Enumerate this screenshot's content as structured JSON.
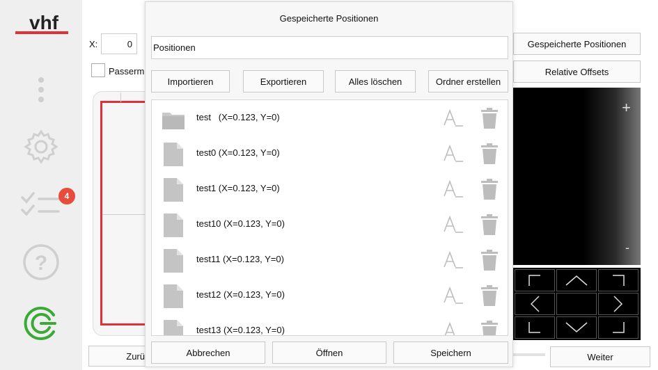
{
  "sidebar": {
    "logo_text": "vhf",
    "badge_count": "4",
    "icons": [
      "menu-dots-icon",
      "settings-gear-icon",
      "task-list-icon",
      "help-icon",
      "vhf-brand-icon"
    ]
  },
  "background": {
    "x_label": "X:",
    "x_value": "0",
    "checkbox_label": "Passerm",
    "saved_positions_button": "Gespeicherte Positionen",
    "relative_offsets_button": "Relative Offsets",
    "back_button": "Zurü",
    "next_button": "Weiter",
    "zoom_plus": "+",
    "zoom_minus": "-"
  },
  "dialog": {
    "title": "Gespeicherte Positionen",
    "name_value": "Positionen",
    "buttons": {
      "import": "Importieren",
      "export": "Exportieren",
      "clear_all": "Alles löschen",
      "create_folder": "Ordner erstellen"
    },
    "items": [
      {
        "type": "folder",
        "label": "test   (X=0.123, Y=0)"
      },
      {
        "type": "file",
        "label": "test0 (X=0.123, Y=0)"
      },
      {
        "type": "file",
        "label": "test1 (X=0.123, Y=0)"
      },
      {
        "type": "file",
        "label": "test10 (X=0.123, Y=0)"
      },
      {
        "type": "file",
        "label": "test11 (X=0.123, Y=0)"
      },
      {
        "type": "file",
        "label": "test12 (X=0.123, Y=0)"
      },
      {
        "type": "file",
        "label": "test13 (X=0.123, Y=0)"
      }
    ],
    "footer": {
      "cancel": "Abbrechen",
      "open": "Öffnen",
      "save": "Speichern"
    }
  },
  "colors": {
    "accent_red": "#e0313b",
    "brand_green": "#3aa935",
    "badge_red": "#e74c3c"
  }
}
